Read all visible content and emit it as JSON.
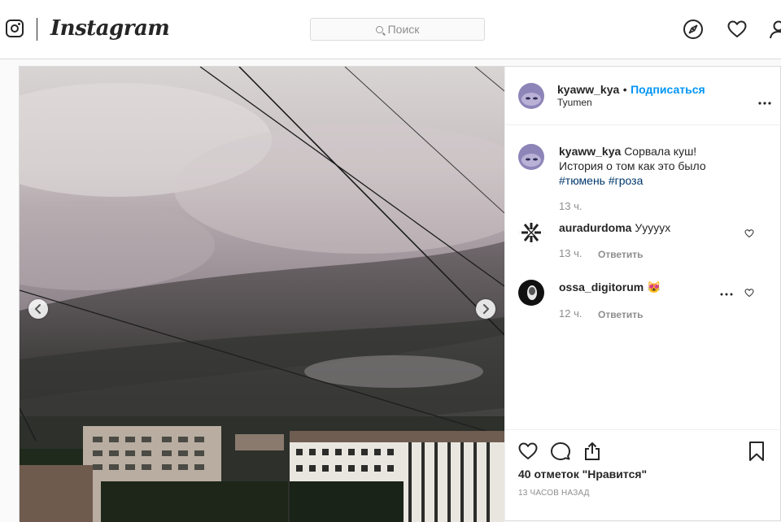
{
  "header": {
    "brand": "Instagram",
    "search_placeholder": "Поиск"
  },
  "post": {
    "author": {
      "username": "kyaww_kya",
      "separator": "•",
      "follow_label": "Подписаться",
      "location": "Tyumen"
    },
    "caption": {
      "username": "kyaww_kya",
      "text_line1": "Сорвала куш!",
      "text_line2": "История о том как это было",
      "hashtag1": "#тюмень",
      "hashtag2": "#гроза",
      "time": "13 ч."
    },
    "comments": [
      {
        "username": "auradurdoma",
        "text": "Уууууx",
        "time": "13 ч.",
        "reply_label": "Ответить"
      },
      {
        "username": "ossa_digitorum",
        "text": "😻",
        "time": "12 ч.",
        "reply_label": "Ответить"
      }
    ],
    "likes_text": "40 отметок \"Нравится\"",
    "posted_ago": "13 часов назад"
  },
  "colors": {
    "link_blue": "#0095f6",
    "hashtag": "#00376b",
    "muted": "#8e8e8e",
    "border": "#dbdbdb"
  },
  "icons": [
    "instagram-logo-icon",
    "search-icon",
    "explore-compass-icon",
    "activity-heart-icon",
    "profile-icon",
    "more-dots-icon",
    "carousel-prev-icon",
    "carousel-next-icon",
    "like-heart-icon",
    "comment-bubble-icon",
    "share-icon",
    "bookmark-icon"
  ]
}
